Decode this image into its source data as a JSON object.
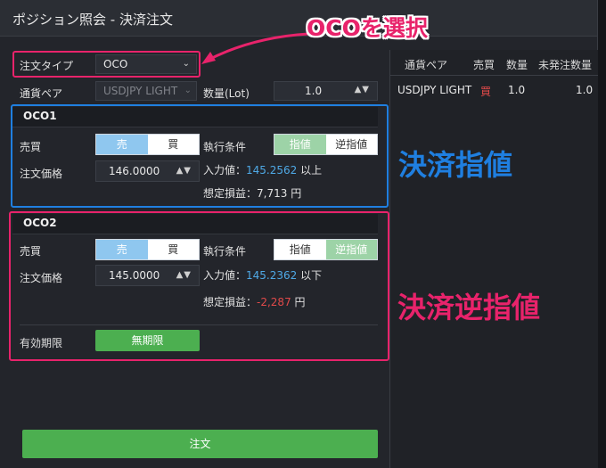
{
  "window": {
    "title": "ポジション照会 - 決済注文"
  },
  "form": {
    "order_type_label": "注文タイプ",
    "order_type_value": "OCO",
    "pair_label": "通貨ペア",
    "pair_value": "USDJPY LIGHT",
    "qty_label": "数量(Lot)",
    "qty_value": "1.0"
  },
  "oco1": {
    "header": "OCO1",
    "side_label": "売買",
    "sell": "売",
    "buy": "買",
    "cond_label": "執行条件",
    "limit": "指値",
    "stop": "逆指値",
    "price_label": "注文価格",
    "price_value": "146.0000",
    "input_label": "入力値：",
    "input_value": "145.2562",
    "input_suffix": "以上",
    "pl_label": "想定損益：",
    "pl_value": "7,713",
    "pl_unit": "円"
  },
  "oco2": {
    "header": "OCO2",
    "side_label": "売買",
    "sell": "売",
    "buy": "買",
    "cond_label": "執行条件",
    "limit": "指値",
    "stop": "逆指値",
    "price_label": "注文価格",
    "price_value": "145.0000",
    "input_label": "入力値：",
    "input_value": "145.2362",
    "input_suffix": "以下",
    "pl_label": "想定損益：",
    "pl_value": "-2,287",
    "pl_unit": "円"
  },
  "expiry": {
    "label": "有効期限",
    "value": "無期限"
  },
  "submit_label": "注文",
  "position_table": {
    "headers": [
      "通貨ペア",
      "売買",
      "数量",
      "未発注数量"
    ],
    "row": {
      "pair": "USDJPY LIGHT",
      "side": "買",
      "qty": "1.0",
      "unordered": "1.0"
    }
  },
  "annotations": {
    "select_oco": "OCOを選択",
    "limit_close": "決済指値",
    "stop_close": "決済逆指値"
  },
  "colors": {
    "annotation_red": "#e8236b",
    "annotation_blue": "#1f7fe0",
    "accent_green": "#4caf50",
    "toggle_blue": "#8fc7ef",
    "toggle_green": "#9dd3a7"
  }
}
